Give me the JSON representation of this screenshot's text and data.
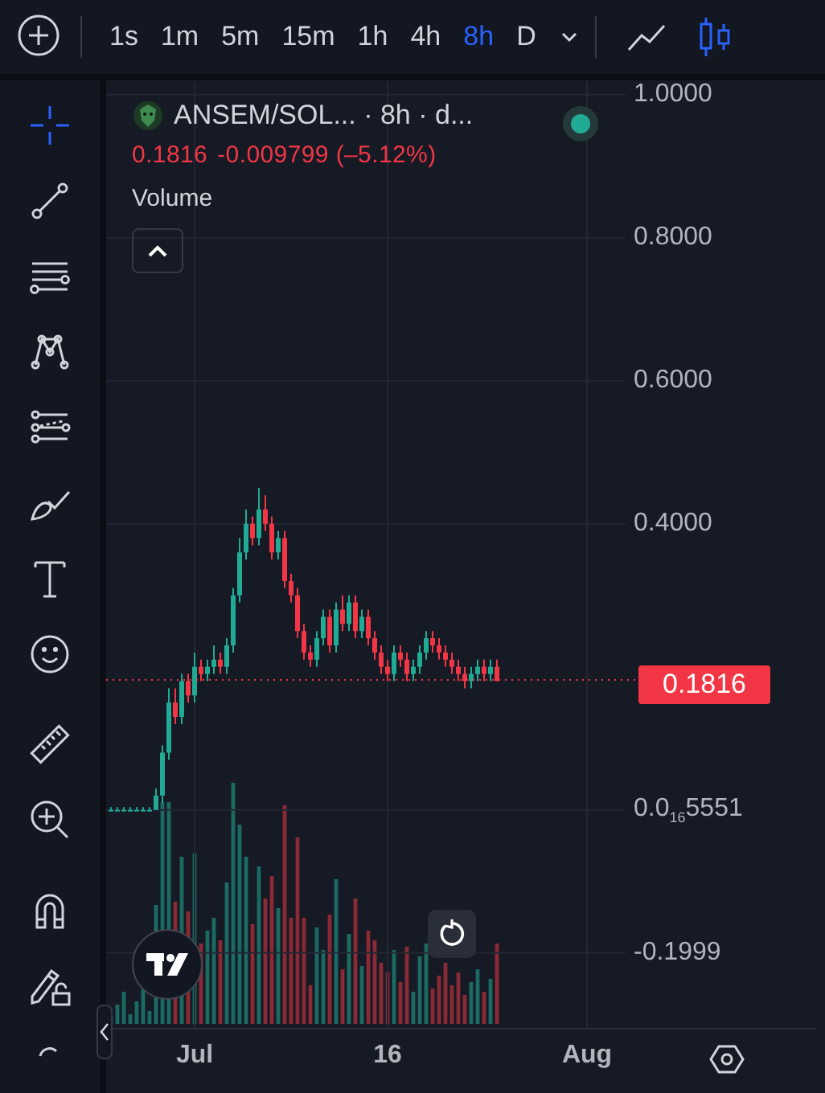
{
  "top_bar": {
    "intervals": [
      {
        "label": "1s",
        "selected": false
      },
      {
        "label": "1m",
        "selected": false
      },
      {
        "label": "5m",
        "selected": false
      },
      {
        "label": "15m",
        "selected": false
      },
      {
        "label": "1h",
        "selected": false
      },
      {
        "label": "4h",
        "selected": false
      },
      {
        "label": "8h",
        "selected": true
      },
      {
        "label": "D",
        "selected": false
      }
    ],
    "chart_types": [
      {
        "kind": "line",
        "selected": false
      },
      {
        "kind": "candles",
        "selected": true
      }
    ]
  },
  "toolbar": {
    "groups": [
      [
        {
          "kind": "crosshair",
          "selected": true
        },
        {
          "kind": "trend-line",
          "selected": false
        },
        {
          "kind": "fib",
          "selected": false
        },
        {
          "kind": "pattern",
          "selected": false
        },
        {
          "kind": "projection",
          "selected": false
        },
        {
          "kind": "brush",
          "selected": false
        },
        {
          "kind": "text",
          "selected": false
        },
        {
          "kind": "emoji",
          "selected": false
        }
      ],
      [
        {
          "kind": "ruler",
          "selected": false
        },
        {
          "kind": "zoom",
          "selected": false
        }
      ],
      [
        {
          "kind": "magnet",
          "selected": false
        },
        {
          "kind": "lock",
          "selected": false
        },
        {
          "kind": "partial",
          "selected": false
        }
      ]
    ]
  },
  "legend": {
    "symbol": "ANSEM/SOL... · 8h · d...",
    "price": "0.1816",
    "change": "-0.009799 (–5.12%)",
    "indicator": "Volume"
  },
  "chart": {
    "chart_data": {
      "type": "candlestick",
      "ylim": [
        -0.306,
        1.02
      ],
      "grid": true,
      "categories": [
        null,
        null,
        null,
        null,
        null,
        null,
        null,
        null,
        null,
        null,
        null,
        null,
        null,
        "Jul",
        null,
        null,
        null,
        null,
        null,
        null,
        null,
        null,
        null,
        null,
        null,
        null,
        null,
        null,
        null,
        null,
        null,
        null,
        null,
        null,
        null,
        null,
        null,
        null,
        null,
        null,
        null,
        null,
        null,
        "16",
        null,
        null,
        null,
        null,
        null,
        null,
        null,
        null,
        null,
        null,
        null,
        null,
        null,
        null,
        null,
        null,
        null,
        null,
        null,
        null,
        null,
        null,
        null,
        null,
        null,
        null,
        null,
        null,
        null,
        null,
        "Aug"
      ],
      "ohlc": [
        [
          0,
          0.004,
          0,
          0
        ],
        [
          0,
          0.004,
          0,
          0
        ],
        [
          0,
          0.004,
          0,
          0
        ],
        [
          0,
          0.004,
          0,
          0
        ],
        [
          0,
          0.004,
          0,
          0
        ],
        [
          0,
          0.004,
          0,
          0
        ],
        [
          0,
          0.004,
          0,
          0
        ],
        [
          0,
          0.03,
          0,
          0.02
        ],
        [
          0.02,
          0.09,
          0.01,
          0.08
        ],
        [
          0.08,
          0.17,
          0.07,
          0.15
        ],
        [
          0.15,
          0.17,
          0.12,
          0.13
        ],
        [
          0.13,
          0.19,
          0.12,
          0.18
        ],
        [
          0.18,
          0.19,
          0.15,
          0.16
        ],
        [
          0.16,
          0.22,
          0.15,
          0.2
        ],
        [
          0.2,
          0.21,
          0.18,
          0.19
        ],
        [
          0.19,
          0.21,
          0.18,
          0.2
        ],
        [
          0.2,
          0.23,
          0.19,
          0.21
        ],
        [
          0.21,
          0.22,
          0.19,
          0.2
        ],
        [
          0.2,
          0.24,
          0.19,
          0.23
        ],
        [
          0.23,
          0.31,
          0.22,
          0.3
        ],
        [
          0.3,
          0.38,
          0.29,
          0.36
        ],
        [
          0.36,
          0.42,
          0.35,
          0.4
        ],
        [
          0.4,
          0.41,
          0.37,
          0.38
        ],
        [
          0.38,
          0.45,
          0.37,
          0.42
        ],
        [
          0.42,
          0.44,
          0.39,
          0.4
        ],
        [
          0.4,
          0.41,
          0.35,
          0.36
        ],
        [
          0.36,
          0.39,
          0.35,
          0.38
        ],
        [
          0.38,
          0.39,
          0.31,
          0.32
        ],
        [
          0.32,
          0.33,
          0.29,
          0.3
        ],
        [
          0.3,
          0.31,
          0.24,
          0.25
        ],
        [
          0.25,
          0.26,
          0.21,
          0.22
        ],
        [
          0.22,
          0.23,
          0.2,
          0.21
        ],
        [
          0.21,
          0.25,
          0.2,
          0.24
        ],
        [
          0.24,
          0.28,
          0.23,
          0.27
        ],
        [
          0.27,
          0.28,
          0.22,
          0.23
        ],
        [
          0.23,
          0.29,
          0.22,
          0.28
        ],
        [
          0.28,
          0.3,
          0.25,
          0.26
        ],
        [
          0.26,
          0.3,
          0.25,
          0.29
        ],
        [
          0.29,
          0.3,
          0.24,
          0.25
        ],
        [
          0.25,
          0.28,
          0.24,
          0.27
        ],
        [
          0.27,
          0.28,
          0.23,
          0.24
        ],
        [
          0.24,
          0.25,
          0.21,
          0.22
        ],
        [
          0.22,
          0.23,
          0.19,
          0.2
        ],
        [
          0.2,
          0.21,
          0.18,
          0.19
        ],
        [
          0.19,
          0.23,
          0.18,
          0.22
        ],
        [
          0.22,
          0.23,
          0.2,
          0.21
        ],
        [
          0.21,
          0.22,
          0.18,
          0.19
        ],
        [
          0.19,
          0.21,
          0.18,
          0.2
        ],
        [
          0.2,
          0.23,
          0.19,
          0.22
        ],
        [
          0.22,
          0.25,
          0.21,
          0.24
        ],
        [
          0.24,
          0.25,
          0.22,
          0.23
        ],
        [
          0.23,
          0.24,
          0.21,
          0.22
        ],
        [
          0.22,
          0.23,
          0.2,
          0.21
        ],
        [
          0.21,
          0.22,
          0.19,
          0.2
        ],
        [
          0.2,
          0.21,
          0.18,
          0.19
        ],
        [
          0.19,
          0.2,
          0.17,
          0.18
        ],
        [
          0.18,
          0.2,
          0.17,
          0.19
        ],
        [
          0.19,
          0.21,
          0.18,
          0.2
        ],
        [
          0.2,
          0.21,
          0.18,
          0.19
        ],
        [
          0.19,
          0.21,
          0.18,
          0.2
        ],
        [
          0.2,
          0.21,
          0.18,
          0.18
        ],
        null,
        null,
        null,
        null,
        null,
        null,
        null,
        null,
        null,
        null,
        null,
        null,
        null,
        null
      ],
      "ref_lines": [
        {
          "axis": "y",
          "value": 0.1816,
          "color": "#f23645",
          "label": "0.1816"
        }
      ],
      "yticks": [
        {
          "value": 1.0,
          "label": "1.0000"
        },
        {
          "value": 0.8,
          "label": "0.8000"
        },
        {
          "value": 0.6,
          "label": "0.6000"
        },
        {
          "value": 0.4,
          "label": "0.4000"
        },
        {
          "value": 5.551e-17,
          "label": "0.0$_{16}$5551"
        },
        {
          "value": -0.1999,
          "label": "-0.1999"
        }
      ]
    }
  }
}
